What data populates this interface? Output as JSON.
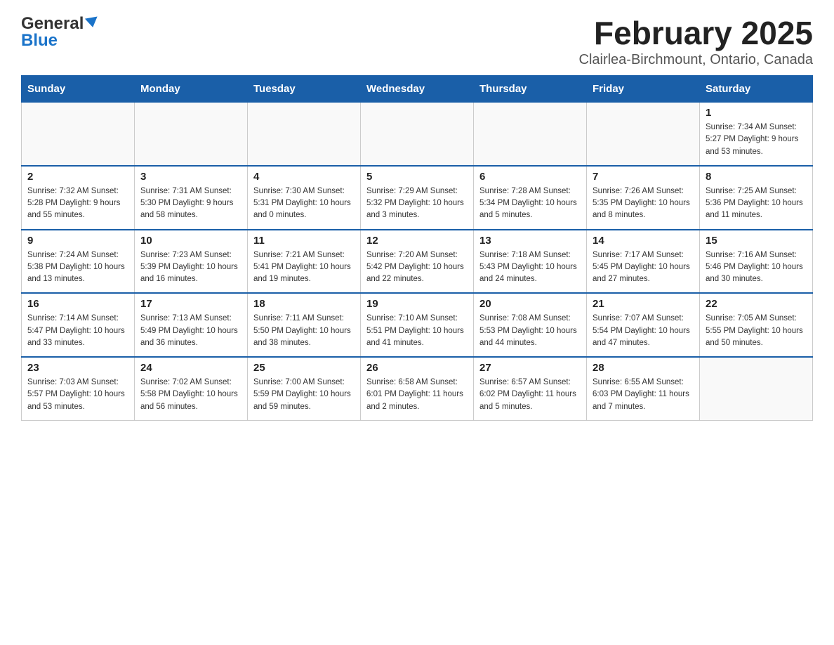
{
  "header": {
    "logo_general": "General",
    "logo_blue": "Blue",
    "title": "February 2025",
    "subtitle": "Clairlea-Birchmount, Ontario, Canada"
  },
  "days_of_week": [
    "Sunday",
    "Monday",
    "Tuesday",
    "Wednesday",
    "Thursday",
    "Friday",
    "Saturday"
  ],
  "weeks": [
    [
      {
        "day": "",
        "info": ""
      },
      {
        "day": "",
        "info": ""
      },
      {
        "day": "",
        "info": ""
      },
      {
        "day": "",
        "info": ""
      },
      {
        "day": "",
        "info": ""
      },
      {
        "day": "",
        "info": ""
      },
      {
        "day": "1",
        "info": "Sunrise: 7:34 AM\nSunset: 5:27 PM\nDaylight: 9 hours and 53 minutes."
      }
    ],
    [
      {
        "day": "2",
        "info": "Sunrise: 7:32 AM\nSunset: 5:28 PM\nDaylight: 9 hours and 55 minutes."
      },
      {
        "day": "3",
        "info": "Sunrise: 7:31 AM\nSunset: 5:30 PM\nDaylight: 9 hours and 58 minutes."
      },
      {
        "day": "4",
        "info": "Sunrise: 7:30 AM\nSunset: 5:31 PM\nDaylight: 10 hours and 0 minutes."
      },
      {
        "day": "5",
        "info": "Sunrise: 7:29 AM\nSunset: 5:32 PM\nDaylight: 10 hours and 3 minutes."
      },
      {
        "day": "6",
        "info": "Sunrise: 7:28 AM\nSunset: 5:34 PM\nDaylight: 10 hours and 5 minutes."
      },
      {
        "day": "7",
        "info": "Sunrise: 7:26 AM\nSunset: 5:35 PM\nDaylight: 10 hours and 8 minutes."
      },
      {
        "day": "8",
        "info": "Sunrise: 7:25 AM\nSunset: 5:36 PM\nDaylight: 10 hours and 11 minutes."
      }
    ],
    [
      {
        "day": "9",
        "info": "Sunrise: 7:24 AM\nSunset: 5:38 PM\nDaylight: 10 hours and 13 minutes."
      },
      {
        "day": "10",
        "info": "Sunrise: 7:23 AM\nSunset: 5:39 PM\nDaylight: 10 hours and 16 minutes."
      },
      {
        "day": "11",
        "info": "Sunrise: 7:21 AM\nSunset: 5:41 PM\nDaylight: 10 hours and 19 minutes."
      },
      {
        "day": "12",
        "info": "Sunrise: 7:20 AM\nSunset: 5:42 PM\nDaylight: 10 hours and 22 minutes."
      },
      {
        "day": "13",
        "info": "Sunrise: 7:18 AM\nSunset: 5:43 PM\nDaylight: 10 hours and 24 minutes."
      },
      {
        "day": "14",
        "info": "Sunrise: 7:17 AM\nSunset: 5:45 PM\nDaylight: 10 hours and 27 minutes."
      },
      {
        "day": "15",
        "info": "Sunrise: 7:16 AM\nSunset: 5:46 PM\nDaylight: 10 hours and 30 minutes."
      }
    ],
    [
      {
        "day": "16",
        "info": "Sunrise: 7:14 AM\nSunset: 5:47 PM\nDaylight: 10 hours and 33 minutes."
      },
      {
        "day": "17",
        "info": "Sunrise: 7:13 AM\nSunset: 5:49 PM\nDaylight: 10 hours and 36 minutes."
      },
      {
        "day": "18",
        "info": "Sunrise: 7:11 AM\nSunset: 5:50 PM\nDaylight: 10 hours and 38 minutes."
      },
      {
        "day": "19",
        "info": "Sunrise: 7:10 AM\nSunset: 5:51 PM\nDaylight: 10 hours and 41 minutes."
      },
      {
        "day": "20",
        "info": "Sunrise: 7:08 AM\nSunset: 5:53 PM\nDaylight: 10 hours and 44 minutes."
      },
      {
        "day": "21",
        "info": "Sunrise: 7:07 AM\nSunset: 5:54 PM\nDaylight: 10 hours and 47 minutes."
      },
      {
        "day": "22",
        "info": "Sunrise: 7:05 AM\nSunset: 5:55 PM\nDaylight: 10 hours and 50 minutes."
      }
    ],
    [
      {
        "day": "23",
        "info": "Sunrise: 7:03 AM\nSunset: 5:57 PM\nDaylight: 10 hours and 53 minutes."
      },
      {
        "day": "24",
        "info": "Sunrise: 7:02 AM\nSunset: 5:58 PM\nDaylight: 10 hours and 56 minutes."
      },
      {
        "day": "25",
        "info": "Sunrise: 7:00 AM\nSunset: 5:59 PM\nDaylight: 10 hours and 59 minutes."
      },
      {
        "day": "26",
        "info": "Sunrise: 6:58 AM\nSunset: 6:01 PM\nDaylight: 11 hours and 2 minutes."
      },
      {
        "day": "27",
        "info": "Sunrise: 6:57 AM\nSunset: 6:02 PM\nDaylight: 11 hours and 5 minutes."
      },
      {
        "day": "28",
        "info": "Sunrise: 6:55 AM\nSunset: 6:03 PM\nDaylight: 11 hours and 7 minutes."
      },
      {
        "day": "",
        "info": ""
      }
    ]
  ]
}
